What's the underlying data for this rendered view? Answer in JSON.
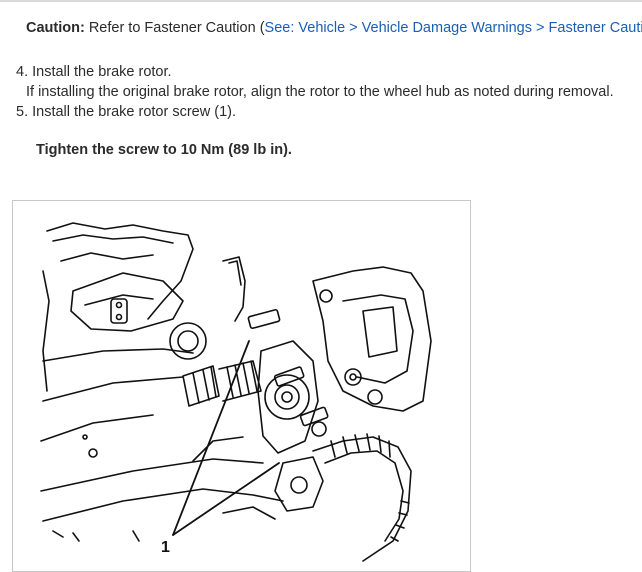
{
  "caution": {
    "label": "Caution:",
    "text": " Refer to Fastener Caution (",
    "link": "See: Vehicle > Vehicle Damage Warnings > Fastener Caution",
    "close": ")."
  },
  "steps": [
    {
      "text": "4. Install the brake rotor."
    },
    {
      "text": "If installing the original brake rotor, align the rotor to the wheel hub as noted during removal."
    },
    {
      "text": "5. Install the brake rotor screw (1)."
    }
  ],
  "specification": "Tighten the screw to 10 Nm (89 lb in).",
  "figure": {
    "callout_label": "1"
  }
}
